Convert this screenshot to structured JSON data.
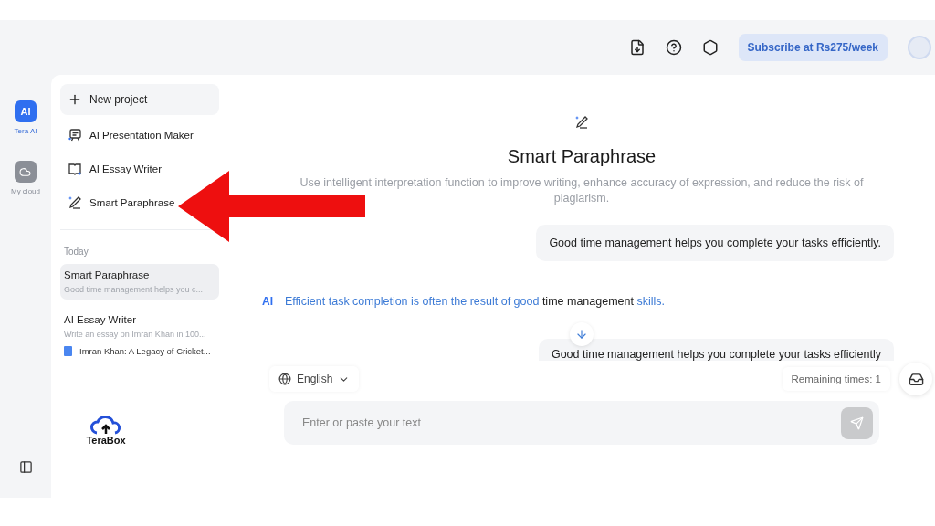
{
  "rail": {
    "items": [
      {
        "label": "Tera AI",
        "selected": true,
        "kind": "ai",
        "icon_text": "AI"
      },
      {
        "label": "My cloud",
        "selected": false,
        "kind": "cloud"
      }
    ]
  },
  "header": {
    "subscribe": "Subscribe at Rs275/week"
  },
  "sidebar": {
    "new_project": "New project",
    "tools": [
      {
        "label": "AI Presentation Maker",
        "kind": "presentation"
      },
      {
        "label": "AI Essay Writer",
        "kind": "essay"
      },
      {
        "label": "Smart Paraphrase",
        "kind": "paraphrase"
      }
    ],
    "history_heading": "Today",
    "history": [
      {
        "title": "Smart Paraphrase",
        "preview": "Good time management helps you c...",
        "selected": true
      },
      {
        "title": "AI Essay Writer",
        "preview": "Write an essay on Imran Khan in 100...",
        "selected": false,
        "document": "Imran Khan: A Legacy of Cricket..."
      }
    ],
    "logo": "TeraBox"
  },
  "main": {
    "title": "Smart Paraphrase",
    "description": "Use intelligent interpretation function to improve writing, enhance accuracy of expression, and reduce the risk of plagiarism.",
    "user_message": "Good time management helps you complete your tasks efficiently.",
    "ai_badge": "AI",
    "ai_response": [
      {
        "text": "Efficient task completion is often the result of good",
        "changed": true
      },
      {
        "text": "time management",
        "changed": false
      },
      {
        "text": "skills.",
        "changed": true
      }
    ],
    "partial_message": "Good time management helps you complete your tasks efficiently",
    "language": "English",
    "remaining": "Remaining times: 1",
    "input": {
      "placeholder": "Enter or paste your text"
    }
  }
}
